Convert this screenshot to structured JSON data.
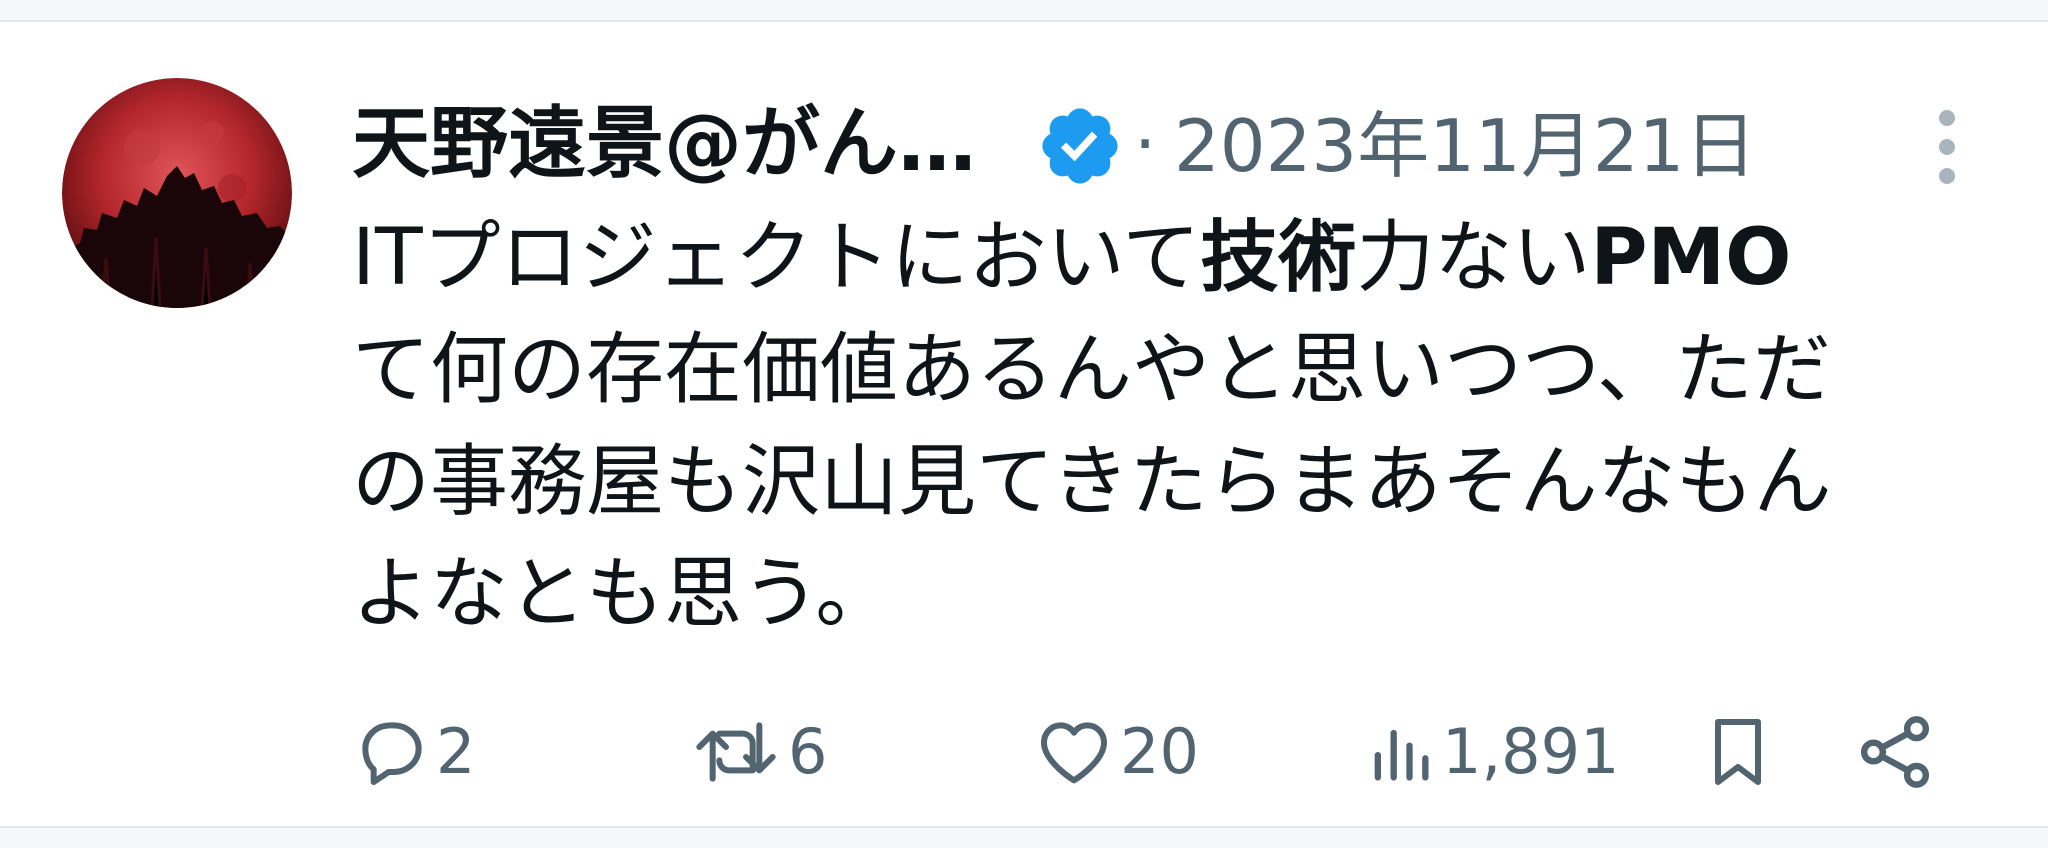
{
  "tweet": {
    "display_name": "天野遠景@がん…",
    "separator": "·",
    "timestamp": "2023年11月21日",
    "text_lines": [
      [
        "ITプロジェクトにおいて",
        "技術",
        "力ない",
        "PMO"
      ],
      [
        "て何の存在価値あるんやと思いつつ、ただ"
      ],
      [
        "の事務屋も沢山見てきたらまあそんなもん"
      ],
      [
        "よなとも思う。"
      ]
    ]
  },
  "actions": {
    "reply": {
      "icon": "reply-icon",
      "count": "2"
    },
    "retweet": {
      "icon": "retweet-icon",
      "count": "6"
    },
    "like": {
      "icon": "heart-icon",
      "count": "20"
    },
    "views": {
      "icon": "views-icon",
      "count": "1,891"
    },
    "bookmark": {
      "icon": "bookmark-icon"
    },
    "share": {
      "icon": "share-icon"
    }
  },
  "colors": {
    "text_primary": "#0f1419",
    "text_secondary": "#536471",
    "verified_blue": "#1d9bf0",
    "avatar_red": "#b3262b"
  }
}
